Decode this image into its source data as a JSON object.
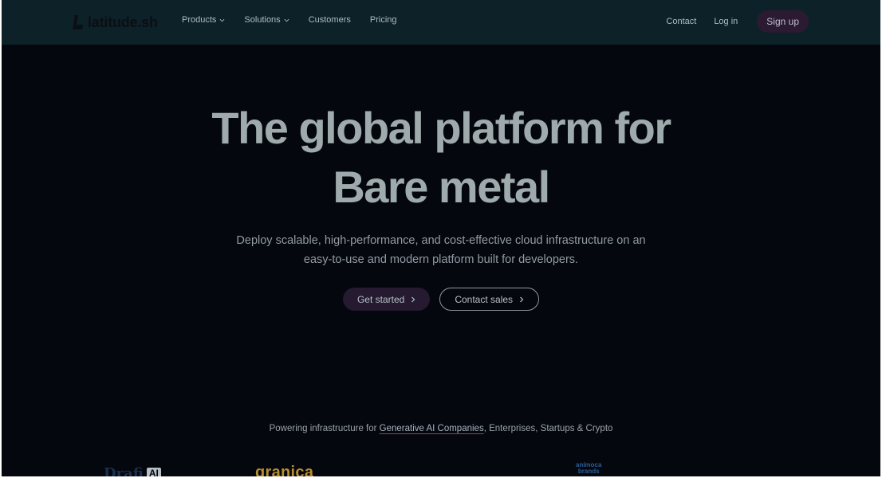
{
  "nav": {
    "logo_text": "latitude.sh",
    "links": [
      {
        "label": "Products",
        "dropdown": true
      },
      {
        "label": "Solutions",
        "dropdown": true
      },
      {
        "label": "Customers",
        "dropdown": false
      },
      {
        "label": "Pricing",
        "dropdown": false
      }
    ],
    "contact_label": "Contact",
    "login_label": "Log in",
    "signup_label": "Sign up"
  },
  "hero": {
    "title_line1": "The global platform for",
    "title_line2": "Bare metal",
    "subtitle_line1": "Deploy scalable, high-performance, and cost-effective cloud infrastructure on an",
    "subtitle_line2": "easy-to-use and modern platform built for developers.",
    "primary_cta": "Get started",
    "secondary_cta": "Contact sales"
  },
  "powering": {
    "prefix": "Powering infrastructure for ",
    "link": "Generative AI Companies",
    "suffix": ", Enterprises, Startups & Crypto"
  },
  "customer_logos": [
    {
      "name": "Drafi",
      "badge": "AI"
    },
    {
      "name": "granica"
    },
    {
      "name_line1": "animoca",
      "name_line2": "brands"
    }
  ],
  "colors": {
    "background": "#05070f",
    "nav_background": "#0d2128",
    "signup_background": "#2c1a33",
    "primary_button": "#251a30",
    "link_underline": "#b03a3a"
  }
}
